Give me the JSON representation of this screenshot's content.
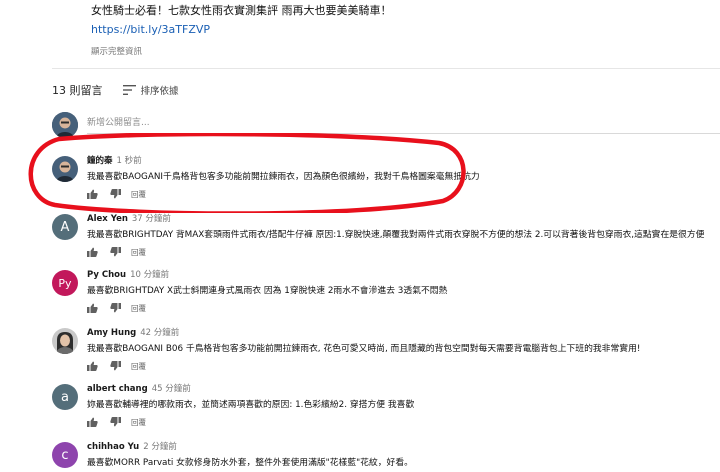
{
  "description": {
    "title": "女性騎士必看！七款女性雨衣實測集評 雨再大也要美美騎車！",
    "link": "https://bit.ly/3aTFZVP",
    "show_more": "顯示完整資訊"
  },
  "comments_header": {
    "count": "13 則留言",
    "sort_label": "排序依據"
  },
  "add_comment": {
    "placeholder": "新增公開留言..."
  },
  "reply_label": "回覆",
  "comments": [
    {
      "author": "鐘的秦",
      "time": "1 秒前",
      "text": "我最喜歡BAOGANI千鳥格背包客多功能前開拉鍊雨衣，因為顏色很繽紛，我對千鳥格圖案毫無抵抗力",
      "avatar": "photo-man"
    },
    {
      "author": "Alex Yen",
      "time": "37 分鐘前",
      "text": "我最喜歡BRIGHTDAY 背MAX套頭雨件式雨衣/搭配牛仔褲 原因:1.穿脫快速,顛覆我對兩件式雨衣穿脫不方便的想法 2.可以背著後背包穿雨衣,這點實在是很方便",
      "avatar": "A",
      "avatar_color": "#546e7a"
    },
    {
      "author": "Py Chou",
      "time": "10 分鐘前",
      "text": "最喜歡BRIGHTDAY X武士斜開連身式風雨衣  因為 1穿脫快速  2雨水不會滲進去  3透氣不悶熱",
      "avatar": "Py",
      "avatar_color": "#c2185b"
    },
    {
      "author": "Amy Hung",
      "time": "42 分鐘前",
      "text": "我最喜歡BAOGANI B06 千鳥格背包客多功能前開拉鍊雨衣, 花色可愛又時尚, 而且隱藏的背包空間對每天需要背電腦背包上下班的我非常實用!",
      "avatar": "photo-woman"
    },
    {
      "author": "albert chang",
      "time": "45 分鐘前",
      "text": "妳最喜歡輔導裡的哪款雨衣，並簡述兩項喜歡的原因: 1.色彩繽紛2. 穿搭方便 我喜歡",
      "avatar": "a",
      "avatar_color": "#546e7a"
    },
    {
      "author": "chihhao Yu",
      "time": "2 分鐘前",
      "text": "最喜歡MORR Parvati 女款修身防水外套，整件外套使用滿版\"花樣藍\"花紋，好看。",
      "avatar": "c",
      "avatar_color": "#8e44ad"
    }
  ]
}
